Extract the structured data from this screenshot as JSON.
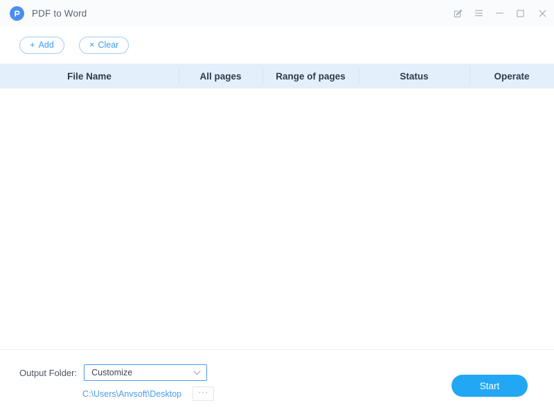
{
  "window": {
    "title": "PDF to Word",
    "logo_icon": "app-logo-p-icon",
    "controls": [
      {
        "name": "feedback-icon",
        "label": ""
      },
      {
        "name": "menu-icon",
        "label": ""
      },
      {
        "name": "minimize-icon",
        "label": ""
      },
      {
        "name": "maximize-icon",
        "label": ""
      },
      {
        "name": "close-icon",
        "label": ""
      }
    ]
  },
  "toolbar": {
    "add_label": "Add",
    "add_glyph": "+",
    "clear_label": "Clear",
    "clear_glyph": "×"
  },
  "table": {
    "headers": [
      "File Name",
      "All pages",
      "Range of pages",
      "Status",
      "Operate"
    ],
    "rows": []
  },
  "footer": {
    "output_folder_label": "Output Folder:",
    "output_mode": "Customize",
    "output_path": "C:\\Users\\Anvsoft\\Desktop",
    "browse_label": "···",
    "start_label": "Start"
  },
  "colors": {
    "accent": "#22a7f4",
    "link": "#4a9cf0",
    "table_header_bg": "#e4effc",
    "titlebar_bg": "#fafbfc",
    "outline_button_border": "#9ecbfa"
  }
}
